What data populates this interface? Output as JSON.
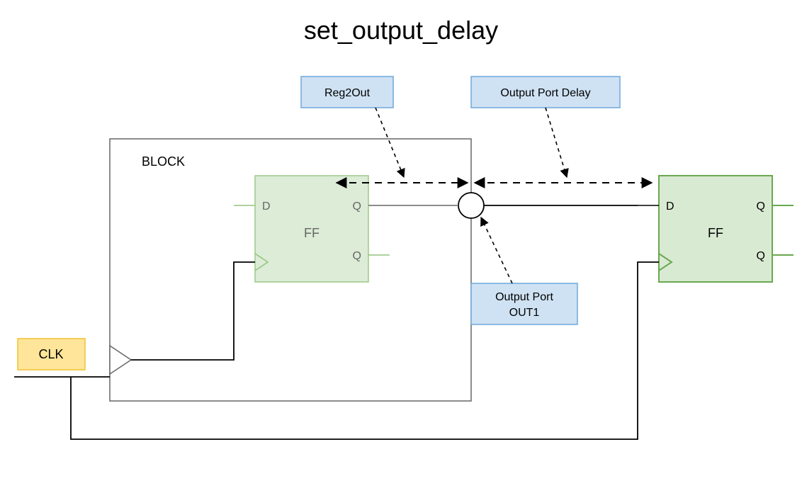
{
  "title": "set_output_delay",
  "block": {
    "label": "BLOCK"
  },
  "ff1": {
    "name": "FF",
    "D": "D",
    "Q1": "Q",
    "Q2": "Q"
  },
  "ff2": {
    "name": "FF",
    "D": "D",
    "Q1": "Q",
    "Q2": "Q"
  },
  "labels": {
    "reg2out": "Reg2Out",
    "output_port_delay": "Output Port Delay",
    "output_port_out1_l1": "Output Port",
    "output_port_out1_l2": "OUT1",
    "clk": "CLK"
  },
  "colors": {
    "blueFill": "#cfe2f3",
    "blueStroke": "#6fa8dc",
    "greenFill": "#d9ead3",
    "greenStroke": "#6aa84f",
    "yellowFill": "#ffe599",
    "yellowStroke": "#f1c232",
    "grayStroke": "#666666",
    "lightGreenStroke": "#93c47d"
  }
}
